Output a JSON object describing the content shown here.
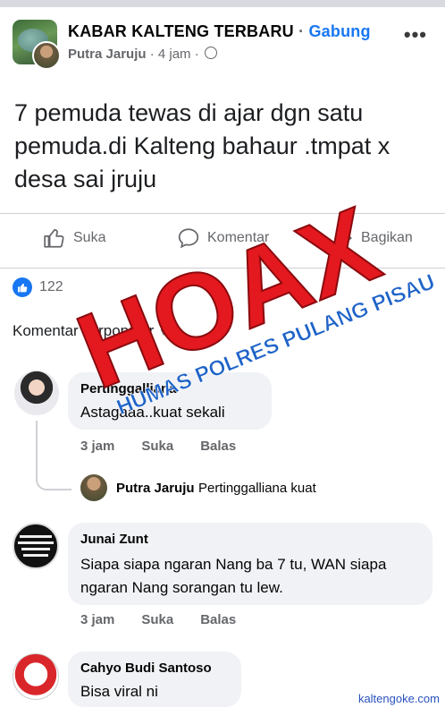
{
  "post": {
    "group_title": "KABAR KALTENG TERBARU",
    "separator": "·",
    "join_label": "Gabung",
    "author": "Putra Jaruju",
    "time": "4 jam",
    "byline_dot": "·",
    "more_label": "•••",
    "text": "7 pemuda tewas di ajar dgn satu pemuda.di Kalteng bahaur .tmpat x desa sai jruju"
  },
  "actions": {
    "like": "Suka",
    "comment": "Komentar",
    "share": "Bagikan"
  },
  "reactions": {
    "count": "122"
  },
  "comments_sort": {
    "label": "Komentar",
    "value": "Terpopuler",
    "arrow": "▼"
  },
  "comments": [
    {
      "name": "Pertinggalliana",
      "text": "Astagaaa..kuat sekali",
      "time": "3 jam",
      "like": "Suka",
      "reply": "Balas"
    },
    {
      "name": "Junai Zunt",
      "text": "Siapa siapa ngaran Nang ba 7 tu, WAN siapa ngaran Nang sorangan tu lew.",
      "time": "3 jam",
      "like": "Suka",
      "reply": "Balas"
    },
    {
      "name": "Cahyo Budi Santoso",
      "text": "Bisa viral ni"
    }
  ],
  "reply": {
    "name": "Putra Jaruju",
    "text": "Pertinggalliana kuat"
  },
  "stamp": {
    "main": "HOAX",
    "sub": "HUMAS POLRES PULANG PISAU",
    "main_color": "#e3191f",
    "sub_color": "#1e63c8"
  },
  "watermark": "kaltengoke.com",
  "colors": {
    "accent": "#1877f2",
    "secondary_text": "#65676b",
    "bubble": "#f0f2f5"
  }
}
